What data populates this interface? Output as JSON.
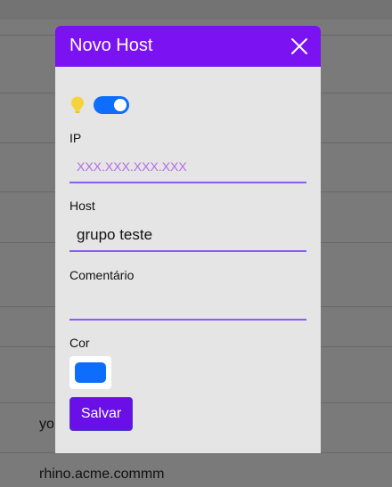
{
  "background": {
    "rows": [
      "yo",
      "rhino.acme.commm"
    ]
  },
  "modal": {
    "title": "Novo Host",
    "toggle_on": true,
    "fields": {
      "ip": {
        "label": "IP",
        "value": "",
        "placeholder": "XXX.XXX.XXX.XXX"
      },
      "host": {
        "label": "Host",
        "value": "grupo teste",
        "placeholder": ""
      },
      "comment": {
        "label": "Comentário",
        "value": "",
        "placeholder": ""
      }
    },
    "color": {
      "label": "Cor",
      "value": "#0d6efd"
    },
    "save_label": "Salvar"
  },
  "colors": {
    "accent": "#7a12f2",
    "toggle": "#0d6efd",
    "bulb": "#f5d33b"
  }
}
